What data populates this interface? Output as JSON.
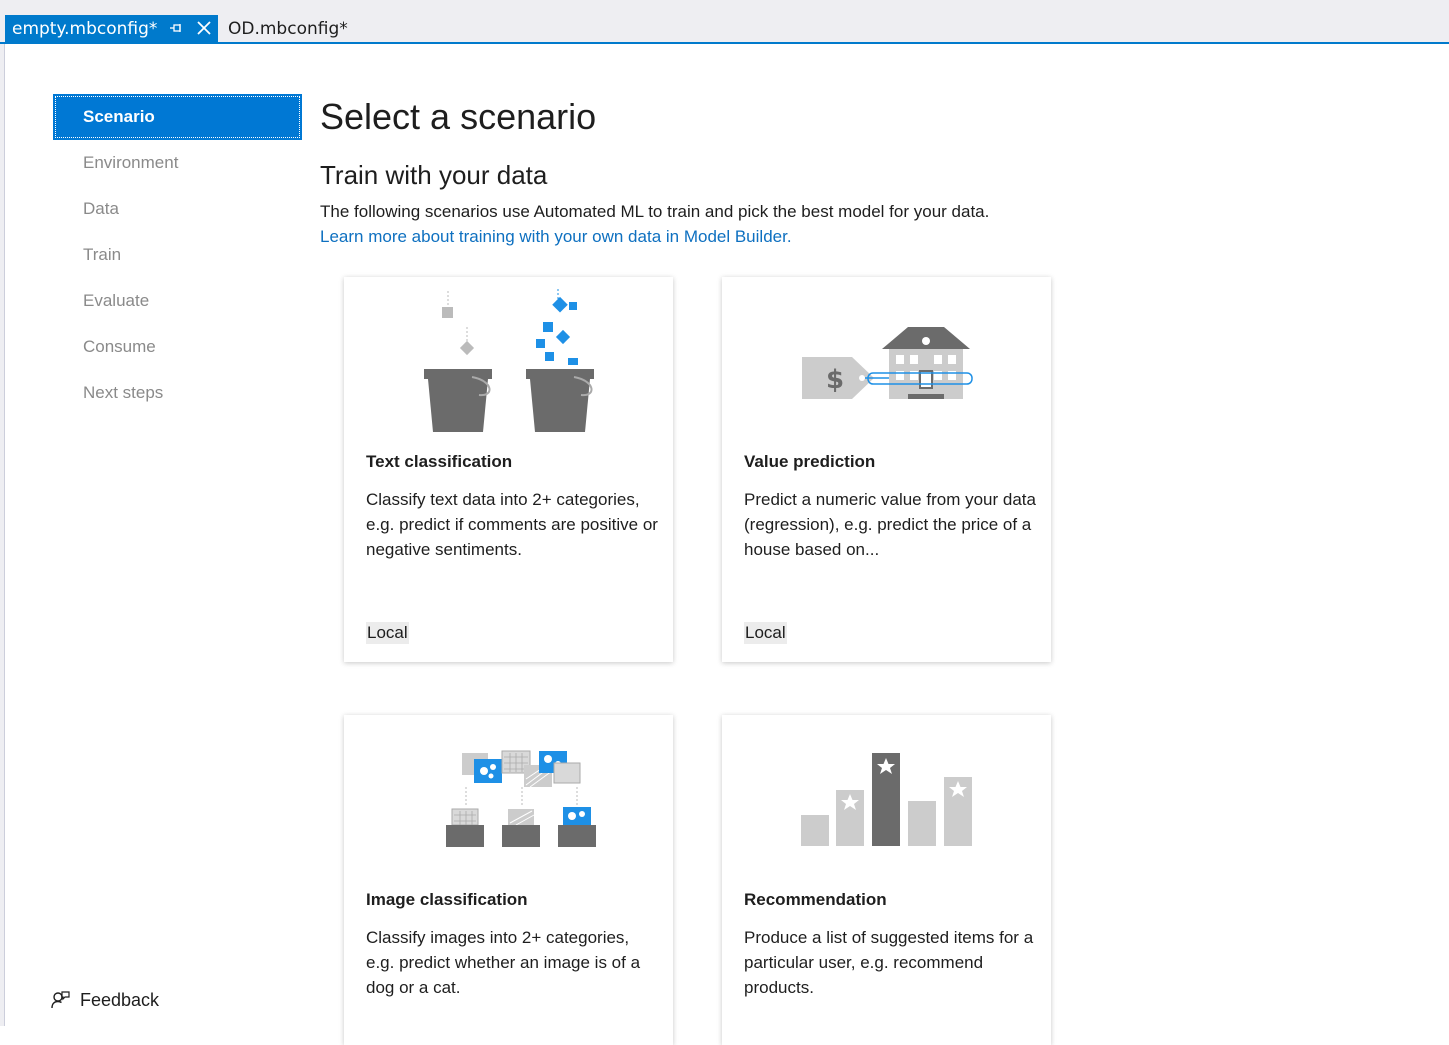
{
  "tabs": [
    {
      "label": "empty.mbconfig*",
      "active": true
    },
    {
      "label": "OD.mbconfig*",
      "active": false
    }
  ],
  "sidebar": {
    "items": [
      {
        "label": "Scenario",
        "active": true
      },
      {
        "label": "Environment"
      },
      {
        "label": "Data"
      },
      {
        "label": "Train"
      },
      {
        "label": "Evaluate"
      },
      {
        "label": "Consume"
      },
      {
        "label": "Next steps"
      }
    ],
    "feedback_label": "Feedback"
  },
  "main": {
    "title": "Select a scenario",
    "section_title": "Train with your data",
    "description": "The following scenarios use Automated ML to train and pick the best model for your data.",
    "learn_more_link": "Learn more about training with your own data in Model Builder."
  },
  "cards": [
    {
      "title": "Text classification",
      "description": "Classify text data into 2+ categories, e.g. predict if comments are positive or negative sentiments.",
      "badge": "Local",
      "icon": "text-classification-illustration"
    },
    {
      "title": "Value prediction",
      "description": "Predict a numeric value from your data (regression), e.g. predict the price of a house based on...",
      "badge": "Local",
      "icon": "value-prediction-illustration"
    },
    {
      "title": "Image classification",
      "description": "Classify images into 2+ categories, e.g. predict whether an image is of a dog or a cat.",
      "icon": "image-classification-illustration"
    },
    {
      "title": "Recommendation",
      "description": "Produce a list of suggested items for a particular user, e.g. recommend products.",
      "icon": "recommendation-illustration"
    }
  ],
  "colors": {
    "accent": "#007acc",
    "nav_active": "#0078d4",
    "link": "#0e70c0",
    "illustration_blue": "#1e90e6",
    "illustration_gray": "#6b6b6b",
    "illustration_light": "#cccccc"
  }
}
